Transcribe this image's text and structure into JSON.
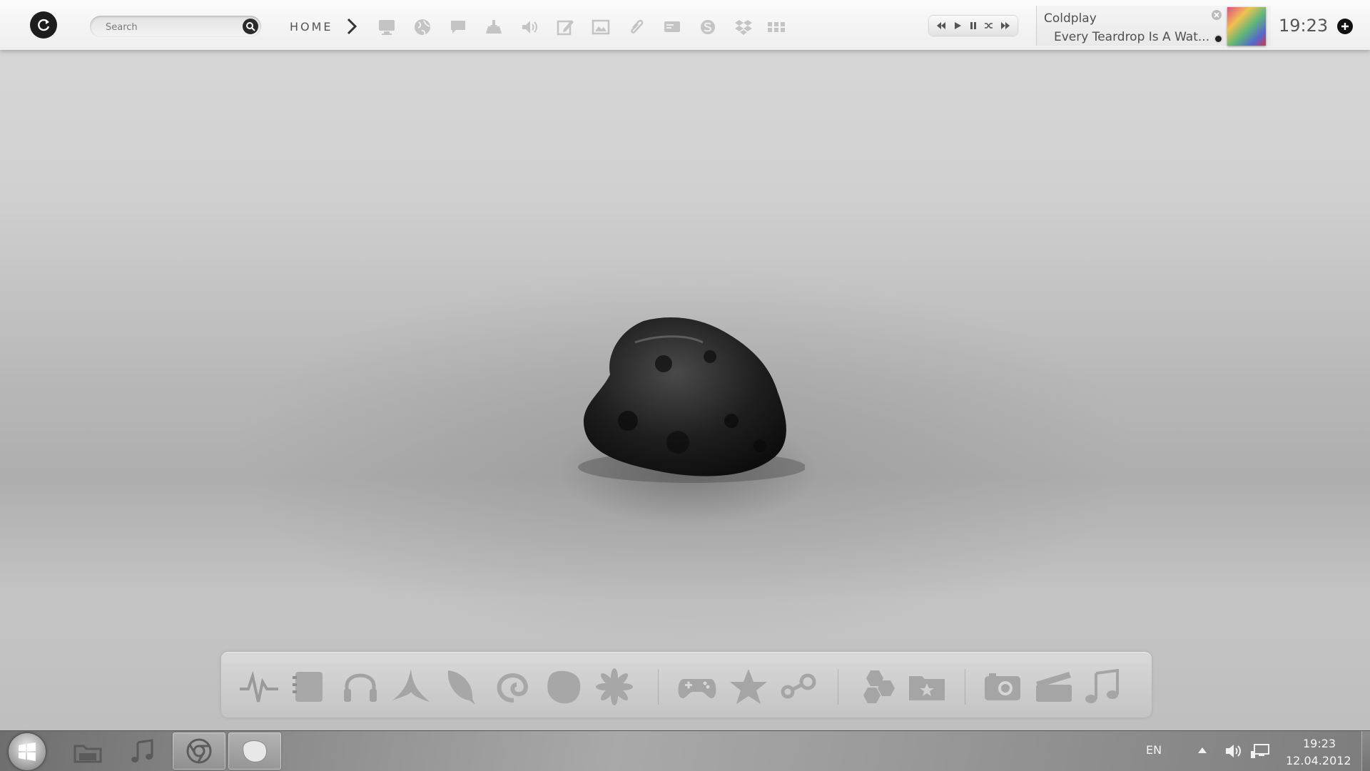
{
  "topbar": {
    "search": {
      "placeholder": "Search",
      "value": ""
    },
    "home_label": "HOME",
    "quick_icons": [
      "monitor-icon",
      "globe-icon",
      "chat-icon",
      "cloud-download-icon",
      "speaker-icon",
      "edit-icon",
      "image-icon",
      "paperclip-icon",
      "messenger-icon",
      "skype-icon",
      "dropbox-icon",
      "grid-icon"
    ],
    "media_controls": [
      "previous-icon",
      "play-icon",
      "pause-icon",
      "shuffle-icon",
      "next-icon"
    ],
    "now_playing": {
      "artist": "Coldplay",
      "track": "Every Teardrop Is A Wat..."
    },
    "clock": "19:23"
  },
  "dock": {
    "items": [
      "activity-icon",
      "notepad-icon",
      "headphones-icon",
      "app-icon",
      "feather-icon",
      "spiral-icon",
      "blob-icon",
      "flower-icon",
      "gamepad-icon",
      "star-icon",
      "steam-icon",
      "hexagons-icon",
      "folder-star-icon",
      "camera-icon",
      "film-icon",
      "music-note-icon"
    ]
  },
  "taskbar": {
    "pinned": [
      "file-manager-icon",
      "music-icon",
      "chrome-icon",
      "chat-bubble-icon"
    ],
    "language": "EN",
    "time": "19:23",
    "date": "12.04.2012"
  },
  "colors": {
    "topbar_bg": "#f2f2f2",
    "taskbar_bg": "#8b8b8b",
    "icon_gray": "#c2c2c2"
  }
}
